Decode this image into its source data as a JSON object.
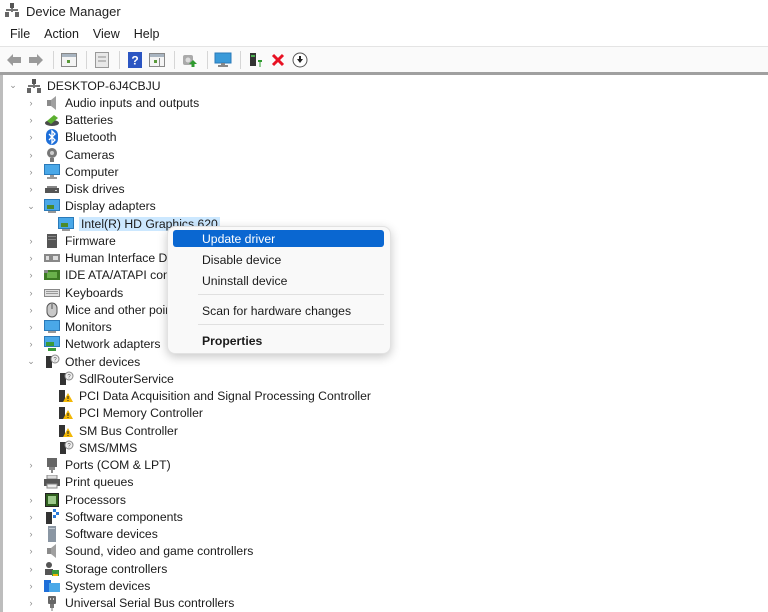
{
  "window": {
    "title": "Device Manager",
    "icon": "device-manager-icon"
  },
  "menubar": [
    "File",
    "Action",
    "View",
    "Help"
  ],
  "toolbar": {
    "buttons": [
      {
        "name": "back",
        "icon": "back-arrow-icon"
      },
      {
        "name": "forward",
        "icon": "forward-arrow-icon"
      },
      {
        "name": "show-hide-console-tree",
        "icon": "console-tree-icon"
      },
      {
        "name": "properties",
        "icon": "properties-sheet-icon"
      },
      {
        "name": "help",
        "icon": "help-icon"
      },
      {
        "name": "show-action-pane",
        "icon": "action-pane-icon"
      },
      {
        "name": "update-driver",
        "icon": "update-driver-icon"
      },
      {
        "name": "scan-hardware",
        "icon": "monitor-scan-icon"
      },
      {
        "name": "add-legacy-hardware",
        "icon": "add-hardware-icon"
      },
      {
        "name": "uninstall-device",
        "icon": "red-x-icon"
      },
      {
        "name": "disable-device",
        "icon": "down-arrow-circle-icon"
      }
    ],
    "red_x_color": "#e81123"
  },
  "tree": {
    "root": {
      "label": "DESKTOP-6J4CBJU",
      "expanded": true
    },
    "categories": [
      {
        "label": "Audio inputs and outputs",
        "icon": "speaker-icon",
        "expanded": false
      },
      {
        "label": "Batteries",
        "icon": "battery-icon",
        "expanded": false
      },
      {
        "label": "Bluetooth",
        "icon": "bluetooth-icon",
        "expanded": false
      },
      {
        "label": "Cameras",
        "icon": "camera-icon",
        "expanded": false
      },
      {
        "label": "Computer",
        "icon": "computer-icon",
        "expanded": false
      },
      {
        "label": "Disk drives",
        "icon": "disk-drive-icon",
        "expanded": false
      },
      {
        "label": "Display adapters",
        "icon": "display-adapter-icon",
        "expanded": true,
        "children": [
          {
            "label": "Intel(R) HD Graphics 620",
            "icon": "display-adapter-icon",
            "selected": true
          }
        ]
      },
      {
        "label": "Firmware",
        "icon": "firmware-icon",
        "expanded": false
      },
      {
        "label": "Human Interface Devices",
        "visible_label": "Human Interface Dev",
        "icon": "hid-icon",
        "expanded": false
      },
      {
        "label": "IDE ATA/ATAPI controllers",
        "visible_label": "IDE ATA/ATAPI control",
        "icon": "ide-controller-icon",
        "expanded": false
      },
      {
        "label": "Keyboards",
        "icon": "keyboard-icon",
        "expanded": false
      },
      {
        "label": "Mice and other pointing devices",
        "visible_label": "Mice and other point",
        "icon": "mouse-icon",
        "expanded": false
      },
      {
        "label": "Monitors",
        "icon": "monitor-icon",
        "expanded": false
      },
      {
        "label": "Network adapters",
        "icon": "network-adapter-icon",
        "expanded": false
      },
      {
        "label": "Other devices",
        "icon": "other-devices-icon",
        "expanded": true,
        "children": [
          {
            "label": "SdlRouterService",
            "icon": "unknown-device-icon",
            "warning": false
          },
          {
            "label": "PCI Data Acquisition and Signal Processing Controller",
            "icon": "warning-device-icon",
            "warning": true
          },
          {
            "label": "PCI Memory Controller",
            "icon": "warning-device-icon",
            "warning": true
          },
          {
            "label": "SM Bus Controller",
            "icon": "warning-device-icon",
            "warning": true
          },
          {
            "label": "SMS/MMS",
            "icon": "unknown-device-icon",
            "warning": false
          }
        ]
      },
      {
        "label": "Ports (COM & LPT)",
        "icon": "port-icon",
        "expanded": false
      },
      {
        "label": "Print queues",
        "icon": "printer-icon",
        "expanded": false
      },
      {
        "label": "Processors",
        "icon": "processor-icon",
        "expanded": false
      },
      {
        "label": "Software components",
        "icon": "software-component-icon",
        "expanded": false
      },
      {
        "label": "Software devices",
        "icon": "software-device-icon",
        "expanded": false
      },
      {
        "label": "Sound, video and game controllers",
        "icon": "speaker-icon",
        "expanded": false
      },
      {
        "label": "Storage controllers",
        "icon": "storage-controller-icon",
        "expanded": false
      },
      {
        "label": "System devices",
        "icon": "system-devices-icon",
        "expanded": false
      },
      {
        "label": "Universal Serial Bus controllers",
        "icon": "usb-icon",
        "expanded": false
      }
    ]
  },
  "context_menu": {
    "items": [
      {
        "label": "Update driver",
        "highlighted": true
      },
      {
        "label": "Disable device"
      },
      {
        "label": "Uninstall device"
      },
      {
        "separator": true
      },
      {
        "label": "Scan for hardware changes"
      },
      {
        "separator": true
      },
      {
        "label": "Properties",
        "bold": true
      }
    ],
    "highlight_color": "#0a67d1"
  },
  "colors": {
    "selection_bg": "#cce8ff",
    "warning_yellow": "#f2b705"
  }
}
